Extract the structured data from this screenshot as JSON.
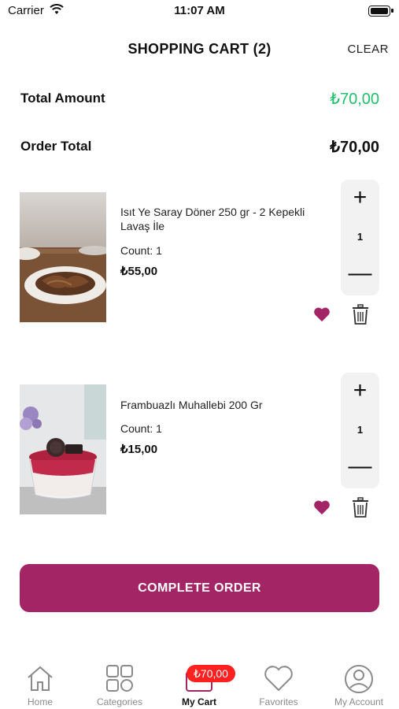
{
  "status_bar": {
    "carrier": "Carrier",
    "time": "11:07 AM"
  },
  "header": {
    "title": "SHOPPING CART (2)",
    "clear_label": "CLEAR"
  },
  "summary": {
    "total_amount_label": "Total Amount",
    "total_amount_value": "₺70,00",
    "order_total_label": "Order Total",
    "order_total_value": "₺70,00"
  },
  "cart_items": [
    {
      "name": "Isıt Ye Saray Döner 250 gr - 2 Kepekli Lavaş İle",
      "count_label": "Count:  1",
      "price": "₺55,00",
      "quantity": "1",
      "favorite": true
    },
    {
      "name": "Frambuazlı Muhallebi 200 Gr",
      "count_label": "Count:  1",
      "price": "₺15,00",
      "quantity": "1",
      "favorite": true
    }
  ],
  "stepper": {
    "plus": "+",
    "minus": "—"
  },
  "complete_order_label": "COMPLETE ORDER",
  "tab_bar": {
    "items": [
      {
        "label": "Home",
        "icon": "home-icon"
      },
      {
        "label": "Categories",
        "icon": "categories-icon"
      },
      {
        "label": "My Cart",
        "icon": "cart-icon",
        "active": true
      },
      {
        "label": "Favorites",
        "icon": "heart-outline-icon"
      },
      {
        "label": "My Account",
        "icon": "account-icon"
      }
    ],
    "cart_badge": "₺70,00"
  },
  "colors": {
    "accent": "#a42566",
    "price_green": "#1fc06a",
    "badge_red": "#ff2020",
    "heart": "#a42566"
  }
}
